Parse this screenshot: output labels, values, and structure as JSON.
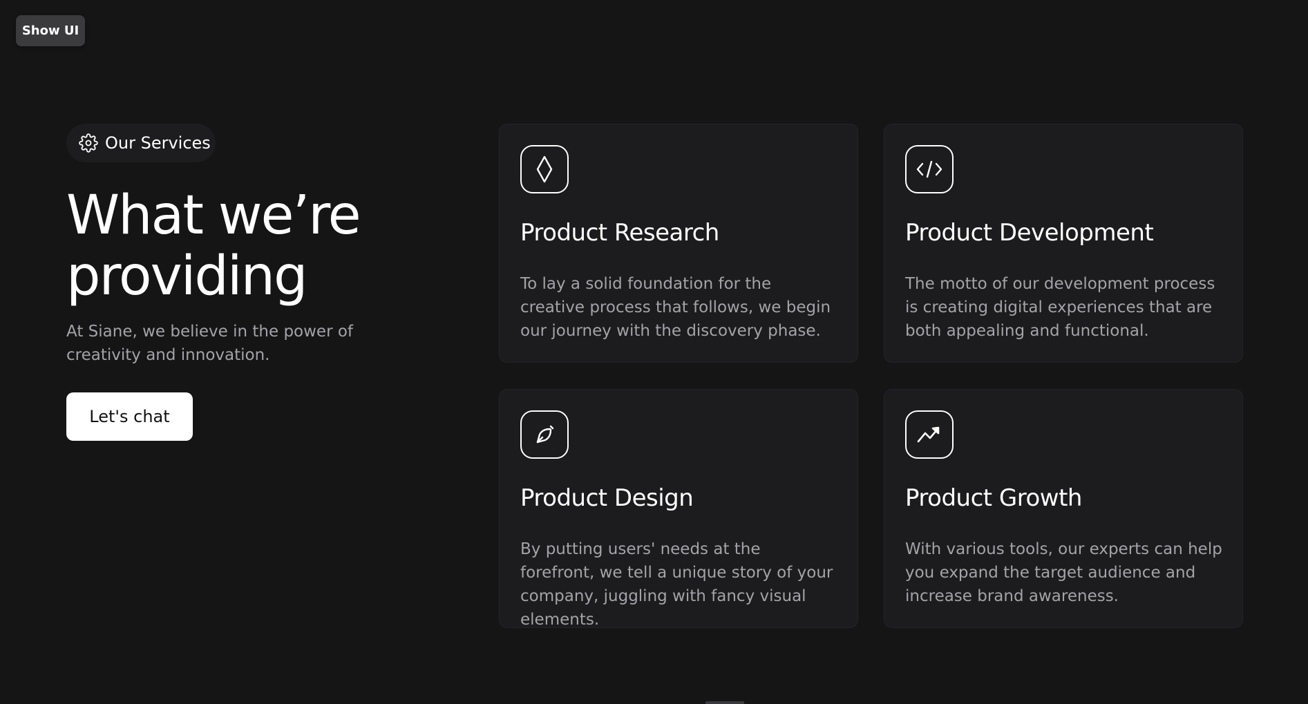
{
  "toolbar": {
    "show_ui_label": "Show UI"
  },
  "hero": {
    "badge_icon": "gear-icon",
    "badge_label": "Our Services",
    "title": "What we’re providing",
    "subtitle": "At Siane, we believe in the power of creativity and innovation.",
    "cta_label": "Let's chat"
  },
  "services": [
    {
      "icon": "diamond-icon",
      "title": "Product Research",
      "description": "To lay a solid foundation for the creative process that follows, we begin our journey with the discovery phase."
    },
    {
      "icon": "code-icon",
      "title": "Product Development",
      "description": "The motto of our development process is creating digital experiences that are both appealing and functional."
    },
    {
      "icon": "pen-nib-icon",
      "title": "Product Design",
      "description": "By putting users' needs at the forefront, we tell a unique story of your company, juggling with fancy visual elements."
    },
    {
      "icon": "growth-chart-icon",
      "title": "Product Growth",
      "description": "With various tools, our experts can help you expand the target audience and increase brand awareness."
    }
  ],
  "colors": {
    "background": "#151516",
    "card": "#1c1c1e",
    "muted_text": "#a3a3a8",
    "accent": "#ffffff"
  }
}
